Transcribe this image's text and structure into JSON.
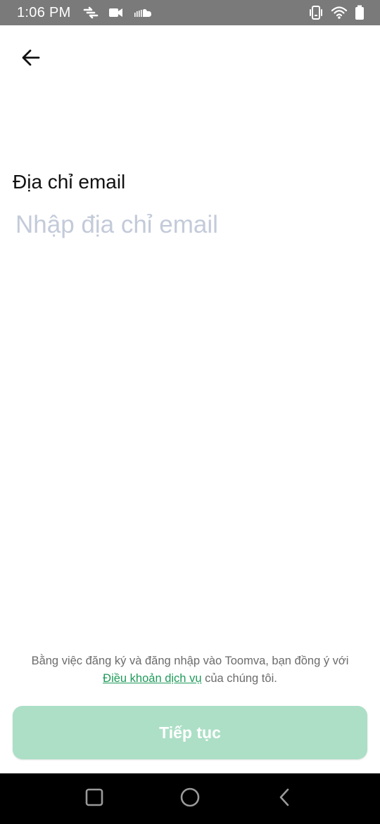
{
  "status_bar": {
    "time": "1:06 PM",
    "icons_left": [
      "sync-icon",
      "video-camera-icon",
      "soundcloud-icon"
    ],
    "icons_right": [
      "vibrate-icon",
      "wifi-icon",
      "battery-icon"
    ]
  },
  "header": {
    "back_icon": "arrow-left-icon"
  },
  "form": {
    "label": "Địa chỉ email",
    "email_value": "",
    "email_placeholder": "Nhập địa chỉ email"
  },
  "terms": {
    "prefix": "Bằng việc đăng ký và đăng nhập vào Toomva, bạn đồng ý với ",
    "link": "Điều khoản dịch vụ",
    "suffix": " của chúng tôi."
  },
  "continue_button": {
    "label": "Tiếp tục",
    "enabled": false
  },
  "nav_bar": {
    "icons": [
      "recents-icon",
      "home-icon",
      "back-nav-icon"
    ]
  },
  "colors": {
    "accent": "#1f9a5a",
    "button_disabled": "#acdfc6",
    "placeholder": "#c3cad9",
    "status_bar": "#7a7a7a"
  }
}
